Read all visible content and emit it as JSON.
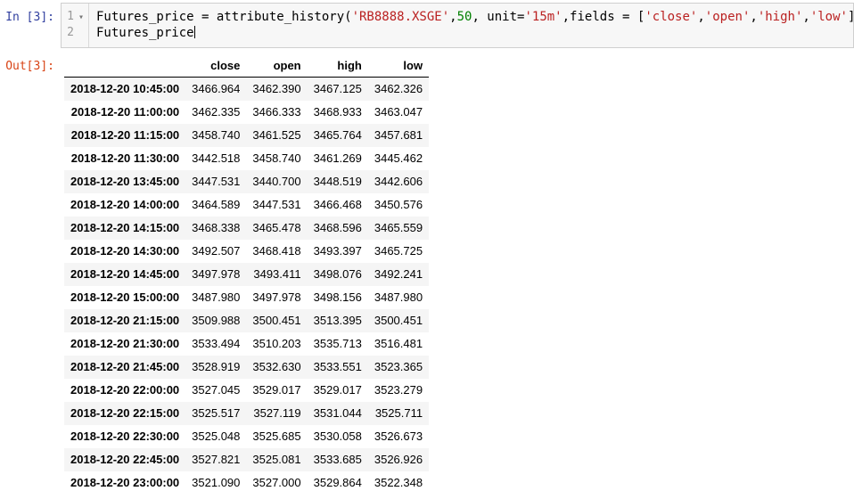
{
  "notebook": {
    "input_prompt": "In [3]:",
    "output_prompt": "Out[3]:",
    "editor": {
      "lines": [
        {
          "line_no": "1",
          "fold_arrow": true,
          "cursor": false,
          "tokens": [
            [
              "plain",
              "Futures_price = attribute_history("
            ],
            [
              "string",
              "'RB8888.XSGE'"
            ],
            [
              "plain",
              ","
            ],
            [
              "number",
              "50"
            ],
            [
              "plain",
              ", unit="
            ],
            [
              "string",
              "'15m'"
            ],
            [
              "plain",
              ",fields = ["
            ],
            [
              "string",
              "'close'"
            ],
            [
              "plain",
              ","
            ],
            [
              "string",
              "'open'"
            ],
            [
              "plain",
              ","
            ],
            [
              "string",
              "'high'"
            ],
            [
              "plain",
              ","
            ],
            [
              "string",
              "'low'"
            ],
            [
              "plain",
              "])"
            ]
          ]
        },
        {
          "line_no": "2",
          "fold_arrow": false,
          "cursor": true,
          "tokens": [
            [
              "plain",
              "Futures_price"
            ]
          ]
        }
      ]
    },
    "dataframe": {
      "index_header": "",
      "columns": [
        "close",
        "open",
        "high",
        "low"
      ],
      "rows": [
        {
          "index": "2018-12-20 10:45:00",
          "values": [
            "3466.964",
            "3462.390",
            "3467.125",
            "3462.326"
          ]
        },
        {
          "index": "2018-12-20 11:00:00",
          "values": [
            "3462.335",
            "3466.333",
            "3468.933",
            "3463.047"
          ]
        },
        {
          "index": "2018-12-20 11:15:00",
          "values": [
            "3458.740",
            "3461.525",
            "3465.764",
            "3457.681"
          ]
        },
        {
          "index": "2018-12-20 11:30:00",
          "values": [
            "3442.518",
            "3458.740",
            "3461.269",
            "3445.462"
          ]
        },
        {
          "index": "2018-12-20 13:45:00",
          "values": [
            "3447.531",
            "3440.700",
            "3448.519",
            "3442.606"
          ]
        },
        {
          "index": "2018-12-20 14:00:00",
          "values": [
            "3464.589",
            "3447.531",
            "3466.468",
            "3450.576"
          ]
        },
        {
          "index": "2018-12-20 14:15:00",
          "values": [
            "3468.338",
            "3465.478",
            "3468.596",
            "3465.559"
          ]
        },
        {
          "index": "2018-12-20 14:30:00",
          "values": [
            "3492.507",
            "3468.418",
            "3493.397",
            "3465.725"
          ]
        },
        {
          "index": "2018-12-20 14:45:00",
          "values": [
            "3497.978",
            "3493.411",
            "3498.076",
            "3492.241"
          ]
        },
        {
          "index": "2018-12-20 15:00:00",
          "values": [
            "3487.980",
            "3497.978",
            "3498.156",
            "3487.980"
          ]
        },
        {
          "index": "2018-12-20 21:15:00",
          "values": [
            "3509.988",
            "3500.451",
            "3513.395",
            "3500.451"
          ]
        },
        {
          "index": "2018-12-20 21:30:00",
          "values": [
            "3533.494",
            "3510.203",
            "3535.713",
            "3516.481"
          ]
        },
        {
          "index": "2018-12-20 21:45:00",
          "values": [
            "3528.919",
            "3532.630",
            "3533.551",
            "3523.365"
          ]
        },
        {
          "index": "2018-12-20 22:00:00",
          "values": [
            "3527.045",
            "3529.017",
            "3529.017",
            "3523.279"
          ]
        },
        {
          "index": "2018-12-20 22:15:00",
          "values": [
            "3525.517",
            "3527.119",
            "3531.044",
            "3525.711"
          ]
        },
        {
          "index": "2018-12-20 22:30:00",
          "values": [
            "3525.048",
            "3525.685",
            "3530.058",
            "3526.673"
          ]
        },
        {
          "index": "2018-12-20 22:45:00",
          "values": [
            "3527.821",
            "3525.081",
            "3533.685",
            "3526.926"
          ]
        },
        {
          "index": "2018-12-20 23:00:00",
          "values": [
            "3521.090",
            "3527.000",
            "3529.864",
            "3522.348"
          ]
        }
      ]
    },
    "colors": {
      "string_token": "#ba2121",
      "number_token": "#008000",
      "in_prompt": "#303f9f",
      "out_prompt": "#d84315",
      "cell_background": "#f7f7f7",
      "cell_border": "#cfcfcf",
      "row_stripe": "#f5f5f5"
    },
    "icons": {
      "fold_arrow": "▾"
    }
  }
}
